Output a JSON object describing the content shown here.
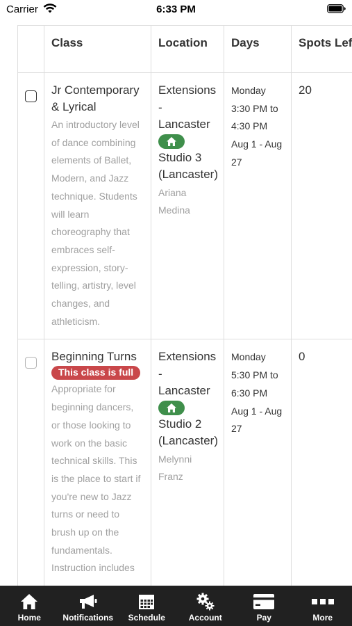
{
  "status_bar": {
    "carrier": "Carrier",
    "time": "6:33 PM"
  },
  "table": {
    "headers": {
      "class": "Class",
      "location": "Location",
      "days": "Days",
      "spots": "Spots Left"
    },
    "rows": [
      {
        "name": "Jr Contemporary & Lyrical",
        "full_badge": "",
        "description": "An introductory level of dance combining elements of Ballet, Modern, and Jazz technique. Students will learn choreography that embraces self-expression, story-telling, artistry, level changes, and athleticism.",
        "location_line1": "Extensions - Lancaster",
        "location_line2": "Studio 3 (Lancaster)",
        "instructor": "Ariana Medina",
        "days": "Monday 3:30 PM to 4:30 PM Aug 1 - Aug 27",
        "spots_left": "20"
      },
      {
        "name": "Beginning Turns",
        "full_badge": "This class is full",
        "description": "Appropriate for beginning dancers, or those looking to work on the basic technical skills. This is the place to start if you're new to Jazz turns or need to brush up on the fundamentals. Instruction includes",
        "location_line1": "Extensions - Lancaster",
        "location_line2": "Studio 2 (Lancaster)",
        "instructor": "Melynni Franz",
        "days": "Monday 5:30 PM to 6:30 PM Aug 1 - Aug 27",
        "spots_left": "0"
      }
    ]
  },
  "tab_bar": {
    "items": [
      {
        "label": "Home",
        "icon": "home-icon"
      },
      {
        "label": "Notifications",
        "icon": "megaphone-icon"
      },
      {
        "label": "Schedule",
        "icon": "calendar-icon"
      },
      {
        "label": "Account",
        "icon": "gears-icon"
      },
      {
        "label": "Pay",
        "icon": "credit-card-icon"
      },
      {
        "label": "More",
        "icon": "more-dots-icon"
      }
    ]
  },
  "colors": {
    "full_badge": "#c9474a",
    "home_pill": "#3f8f4b",
    "tab_bar": "#212121"
  }
}
